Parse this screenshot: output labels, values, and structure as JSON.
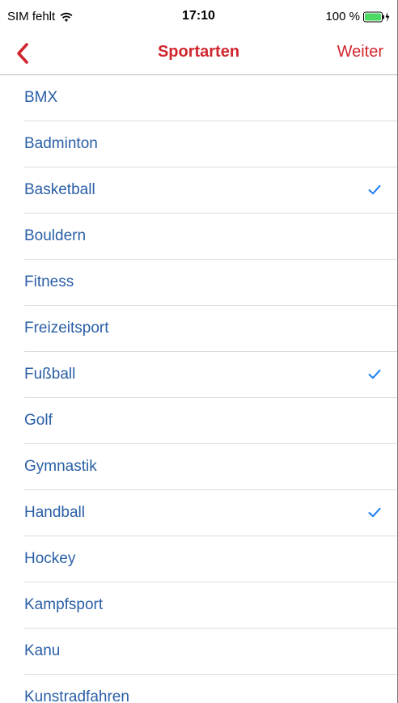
{
  "status_bar": {
    "carrier": "SIM fehlt",
    "time": "17:10",
    "battery": "100 %",
    "icons": [
      "wifi-icon",
      "battery-icon",
      "charging-bolt-icon"
    ]
  },
  "nav": {
    "title": "Sportarten",
    "next_label": "Weiter",
    "back_icon": "chevron-left-icon"
  },
  "colors": {
    "accent": "#d0262e",
    "item_text": "#2a5fa6",
    "check": "#1a7cf2",
    "separator": "#dcdcdc"
  },
  "sports": [
    {
      "label": "BMX",
      "selected": false
    },
    {
      "label": "Badminton",
      "selected": false
    },
    {
      "label": "Basketball",
      "selected": true
    },
    {
      "label": "Bouldern",
      "selected": false
    },
    {
      "label": "Fitness",
      "selected": false
    },
    {
      "label": "Freizeitsport",
      "selected": false
    },
    {
      "label": "Fußball",
      "selected": true
    },
    {
      "label": "Golf",
      "selected": false
    },
    {
      "label": "Gymnastik",
      "selected": false
    },
    {
      "label": "Handball",
      "selected": true
    },
    {
      "label": "Hockey",
      "selected": false
    },
    {
      "label": "Kampfsport",
      "selected": false
    },
    {
      "label": "Kanu",
      "selected": false
    },
    {
      "label": "Kunstradfahren",
      "selected": false
    }
  ]
}
